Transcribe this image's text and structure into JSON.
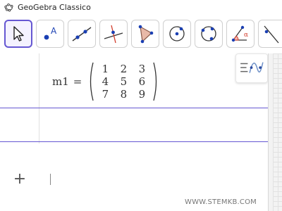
{
  "window": {
    "title": "GeoGebra Classico",
    "icon": "geogebra-logo-icon"
  },
  "toolbar": {
    "tools": [
      {
        "name": "move",
        "icon": "arrow-cursor-icon",
        "active": true
      },
      {
        "name": "point",
        "icon": "point-icon",
        "label": "A"
      },
      {
        "name": "line",
        "icon": "line-icon"
      },
      {
        "name": "perpendicular-line",
        "icon": "perpendicular-icon"
      },
      {
        "name": "polygon",
        "icon": "polygon-icon"
      },
      {
        "name": "circle-center-point",
        "icon": "circle-center-icon"
      },
      {
        "name": "circle-three-points",
        "icon": "circle-three-points-icon"
      },
      {
        "name": "angle",
        "icon": "angle-icon",
        "label": "α"
      },
      {
        "name": "reflect",
        "icon": "reflect-icon"
      }
    ]
  },
  "algebra": {
    "rows": [
      {
        "name": "m1",
        "equals": "=",
        "matrix": [
          [
            "1",
            "2",
            "3"
          ],
          [
            "4",
            "5",
            "6"
          ],
          [
            "7",
            "8",
            "9"
          ]
        ]
      }
    ],
    "input": {
      "add_symbol": "+",
      "value": ""
    },
    "style_bar_icon": "algebra-style-icon"
  },
  "watermark": "WWW.STEMKB.COM",
  "colors": {
    "accent": "#6557d2",
    "point": "#1a3fb3",
    "polygon_fill": "#e8b9a8",
    "angle": "#d23b2b"
  }
}
